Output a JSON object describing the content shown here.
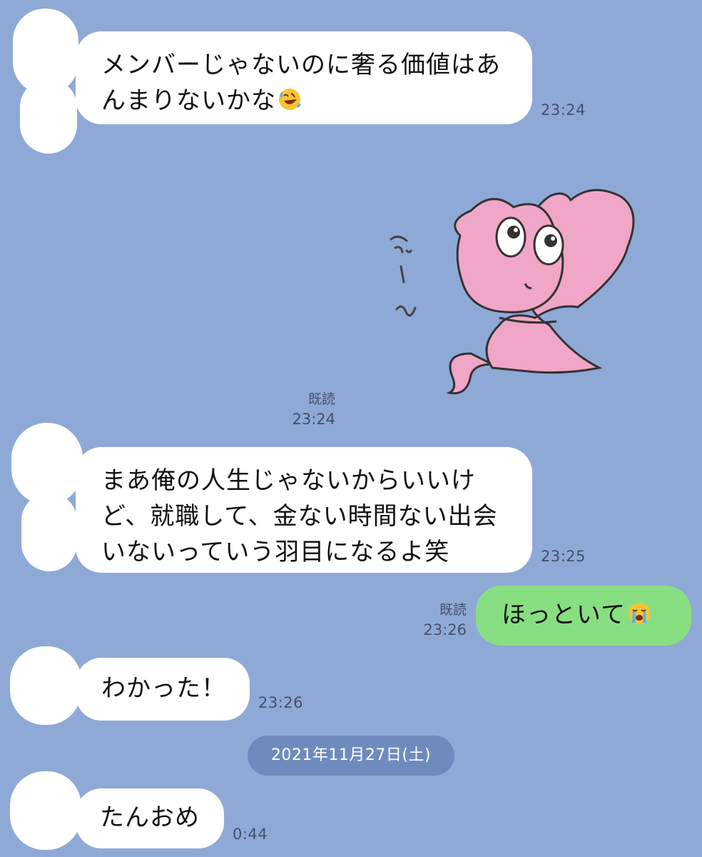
{
  "messages": [
    {
      "text": "メンバーじゃないのに奢る価値はあ\nんまりないかな",
      "emoji": "rolling-on-floor-laughing-emoji",
      "time": "23:24"
    },
    {
      "sticker_text": "ふ\n〜\nん",
      "sticker": "pink-creature-lounging-sticker",
      "read": "既読",
      "time": "23:24"
    },
    {
      "text": "まあ俺の人生じゃないからいいけ\nど、就職して、金ない時間ない出会\nいないっていう羽目になるよ笑",
      "time": "23:25"
    },
    {
      "text": "ほっといて",
      "emoji": "loudly-crying-face-emoji",
      "read": "既読",
      "time": "23:26"
    },
    {
      "text": "わかった！",
      "time": "23:26"
    },
    {
      "text": "たんおめ",
      "time": "0:44"
    }
  ],
  "date_separator": "2021年11月27日(土)",
  "colors": {
    "background": "#8fa9d7",
    "received_bubble": "#ffffff",
    "sent_bubble": "#88df82",
    "date_pill": "#6f8bbd",
    "sticker_pink": "#f0a6c6"
  }
}
